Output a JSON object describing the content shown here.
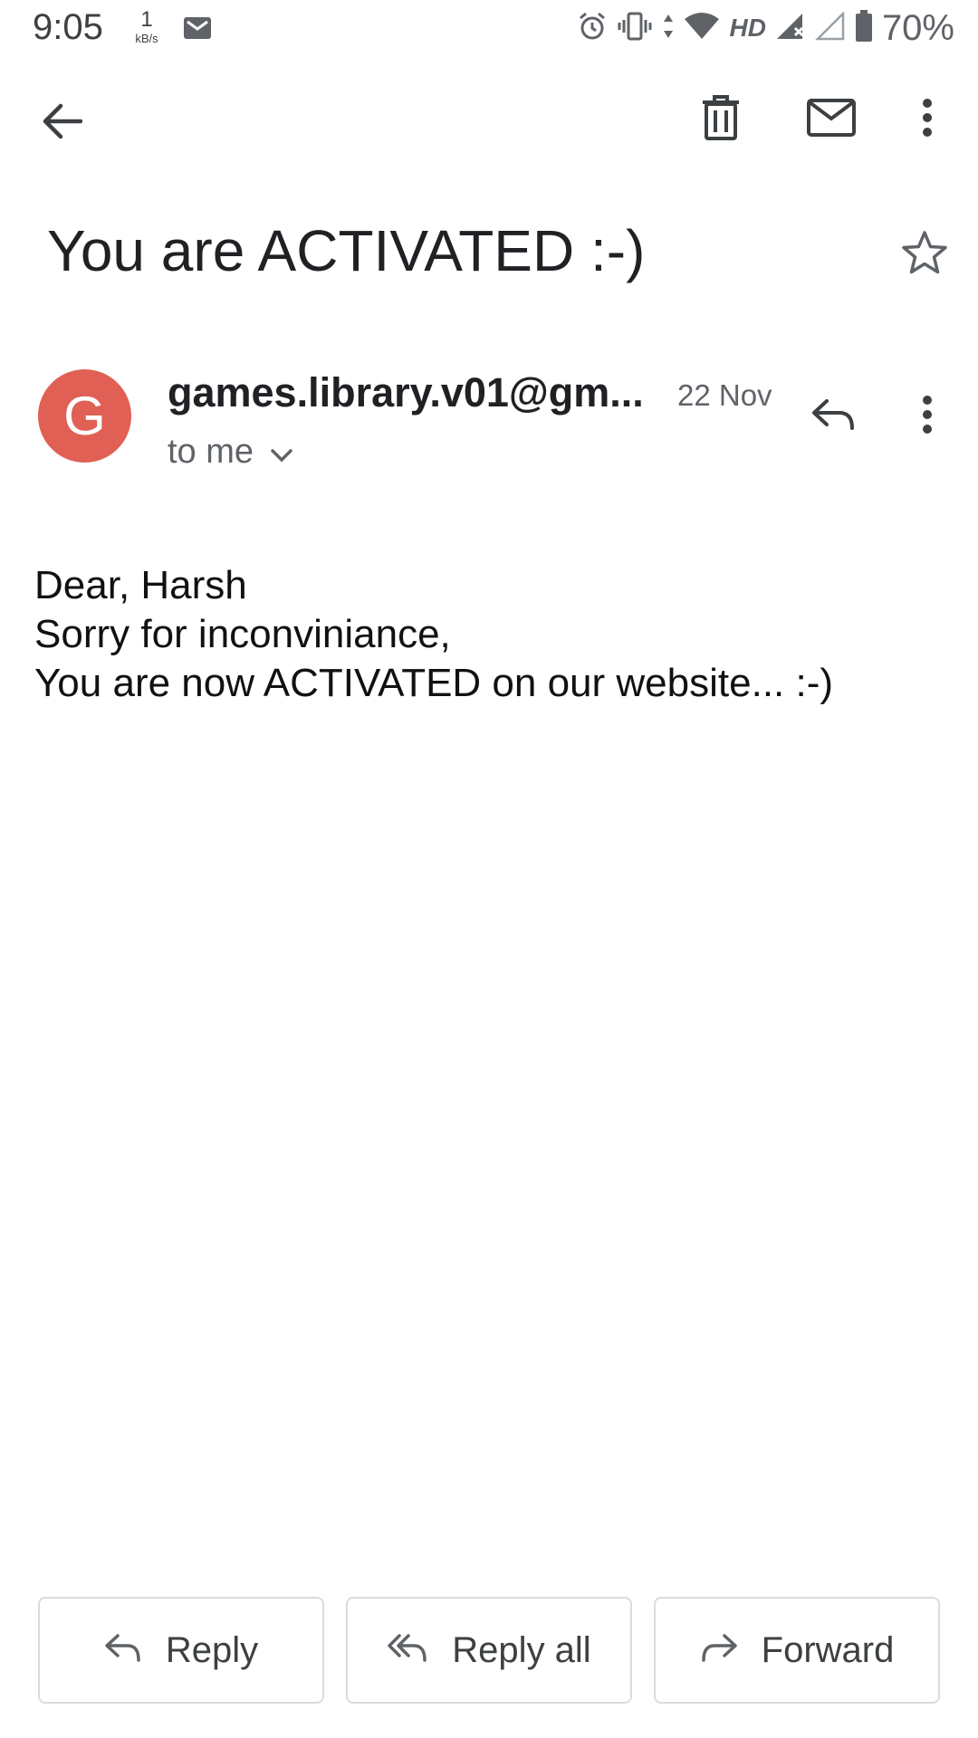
{
  "status_bar": {
    "time": "9:05",
    "net_speed_value": "1",
    "net_speed_unit": "kB/s",
    "network_label": "HD",
    "battery": "70%"
  },
  "toolbar": {
    "back_icon": "arrow-back-icon",
    "delete_icon": "trash-icon",
    "mark_unread_icon": "mail-icon",
    "more_icon": "more-vert-icon"
  },
  "email": {
    "subject": "You are ACTIVATED :-)",
    "avatar_letter": "G",
    "avatar_color": "#e06055",
    "sender": "games.library.v01@gm...",
    "date": "22 Nov",
    "recipient": "to me",
    "body_lines": [
      "Dear, Harsh",
      "Sorry for inconviniance,",
      "You are now ACTIVATED on our website... :-)"
    ]
  },
  "actions": {
    "reply": "Reply",
    "reply_all": "Reply all",
    "forward": "Forward"
  }
}
